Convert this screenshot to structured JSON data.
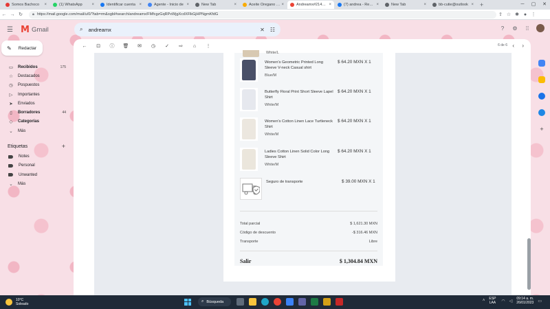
{
  "browser": {
    "tabs": [
      {
        "label": "Somos Bachoco",
        "color": "#e53935"
      },
      {
        "label": "(1) WhatsApp",
        "color": "#25d366"
      },
      {
        "label": "Identificar cuenta",
        "color": "#1877f2"
      },
      {
        "label": "Agente - Inicio de",
        "color": "#4285f4"
      },
      {
        "label": "New Tab",
        "color": "#5f6368"
      },
      {
        "label": "Aceite Oregano 5x",
        "color": "#f9ab00"
      },
      {
        "label": "Andreamx#21483...",
        "color": "#ea4335"
      },
      {
        "label": "(7) andrea - Result",
        "color": "#1877f2"
      },
      {
        "label": "New Tab",
        "color": "#5f6368"
      },
      {
        "label": "bb-cutie@outlook",
        "color": "#5f6368"
      }
    ],
    "active_tab_index": 6,
    "url": "https://mail.google.com/mail/u/0/?tab=rm&ogbl#search/andreamx/FMfcgzGqRPxWjgXcdXFlkGjHPNgmKfdG"
  },
  "gmail": {
    "brand": "Gmail",
    "search_query": "andreamx",
    "compose_label": "Redactar",
    "nav": [
      {
        "icon": "inbox-icon",
        "glyph": "▭",
        "label": "Recibidos",
        "count": "175",
        "bold": true
      },
      {
        "icon": "star-icon",
        "glyph": "☆",
        "label": "Destacados",
        "count": "",
        "bold": false
      },
      {
        "icon": "clock-icon",
        "glyph": "◷",
        "label": "Pospuestos",
        "count": "",
        "bold": false
      },
      {
        "icon": "important-icon",
        "glyph": "▷",
        "label": "Importantes",
        "count": "",
        "bold": false
      },
      {
        "icon": "send-icon",
        "glyph": "➤",
        "label": "Enviados",
        "count": "",
        "bold": false
      },
      {
        "icon": "draft-icon",
        "glyph": "▯",
        "label": "Borradores",
        "count": "44",
        "bold": true
      },
      {
        "icon": "category-icon",
        "glyph": "◇",
        "label": "Categorías",
        "count": "",
        "bold": true
      },
      {
        "icon": "chevron-down-icon",
        "glyph": "⌄",
        "label": "Más",
        "count": "",
        "bold": false
      }
    ],
    "labels_heading": "Etiquetas",
    "labels": [
      {
        "label": "Notes"
      },
      {
        "label": "Personal"
      },
      {
        "label": "Unwanted"
      }
    ],
    "labels_more": "Más",
    "pagination": "6 de 6"
  },
  "order": {
    "items": [
      {
        "name": "Women's Geometric Printed Long Sleeve V-neck Casual shirt",
        "variant": "Blue/M",
        "price": "$ 64.20 MXN X 1",
        "color": "#4a5068"
      },
      {
        "name": "Butterfly Floral Print Short Sleeve Lapel Shirt",
        "variant": "White/M",
        "price": "$ 64.20 MXN X 1",
        "color": "#e6e8ee"
      },
      {
        "name": "Women's Cotton Linen Lace Turtleneck Shirt",
        "variant": "White/M",
        "price": "$ 64.20 MXN X 1",
        "color": "#ece7df"
      },
      {
        "name": "Ladies Cotton Linen Solid Color Long Sleeve Shirt",
        "variant": "White/M",
        "price": "$ 64.20 MXN X 1",
        "color": "#ebe6dc"
      }
    ],
    "shipping_item": {
      "name": "Seguro de transporte",
      "price": "$ 39.00 MXN X 1"
    },
    "cut_variant": "White/L",
    "totals": [
      {
        "label": "Total parcial",
        "value": "$ 1,621.30 MXN"
      },
      {
        "label": "Código de descuento",
        "value": "-$ 316.46 MXN"
      },
      {
        "label": "Transporte",
        "value": "Libre"
      }
    ],
    "grand_total": {
      "label": "Salir",
      "value": "$ 1,304.84 MXN"
    }
  },
  "taskbar": {
    "temperature": "10°C",
    "weather": "Soleado",
    "search_label": "Búsqueda",
    "lang_1": "ESP",
    "lang_2": "LAA",
    "time": "09:14 a. m.",
    "date": "26/01/2023"
  }
}
